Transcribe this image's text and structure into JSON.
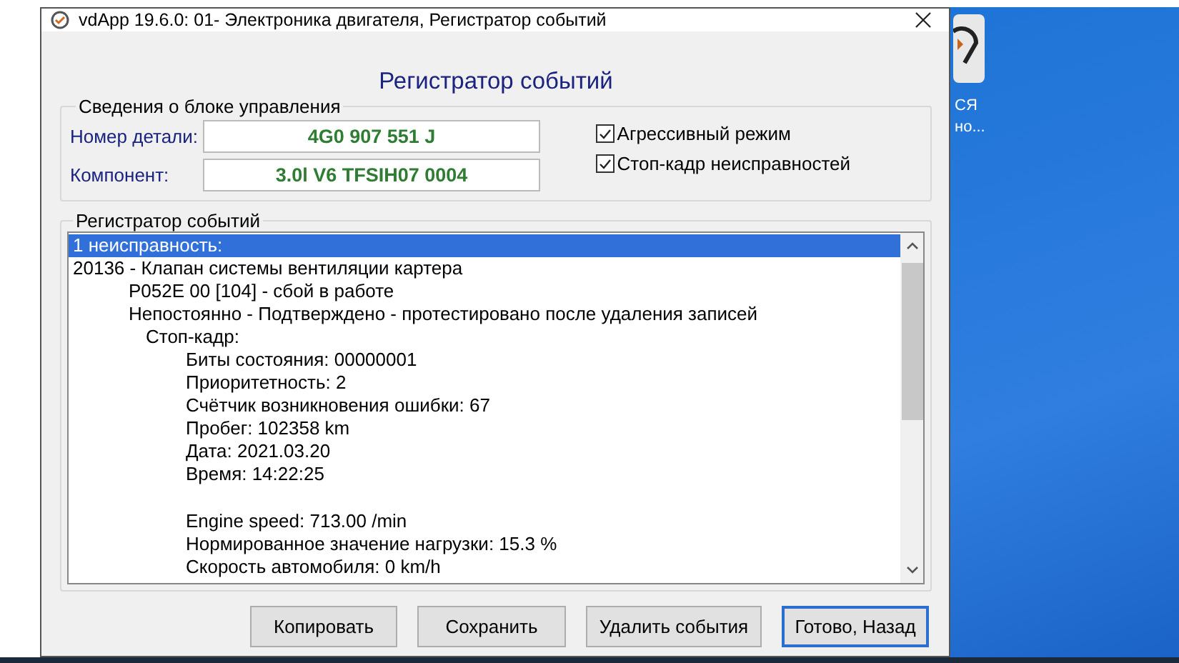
{
  "window": {
    "title": "vdApp 19.6.0: 01- Электроника двигателя,  Регистратор событий"
  },
  "heading": "Регистратор событий",
  "control_unit": {
    "title": "Сведения о блоке управления",
    "fields": [
      {
        "label": "Номер детали:",
        "value": "4G0 907 551 J"
      },
      {
        "label": "Компонент:",
        "value": "3.0l V6 TFSIH07 0004"
      }
    ],
    "options": [
      {
        "label": "Агрессивный режим",
        "checked": true
      },
      {
        "label": "Стоп-кадр неисправностей",
        "checked": true
      }
    ]
  },
  "event_log": {
    "title": "Регистратор событий",
    "items": [
      {
        "text": "1 неисправность:",
        "selected": true
      },
      {
        "text": "20136 - Клапан системы вентиляции картера",
        "selected": false,
        "children": [
          {
            "text": "P052E 00 [104] - сбой в работе",
            "selected": false
          },
          {
            "text": "Непостоянно - Подтверждено - протестировано после удаления записей",
            "selected": false,
            "children": [
              {
                "text": "Стоп-кадр:",
                "selected": false,
                "children": [
                  {
                    "text": "Биты состояния: 00000001",
                    "selected": false
                  },
                  {
                    "text": "Приоритетность: 2",
                    "selected": false
                  },
                  {
                    "text": "Счётчик возникновения ошибки: 67",
                    "selected": false
                  },
                  {
                    "text": "Пробег: 102358 km",
                    "selected": false
                  },
                  {
                    "text": "Дата: 2021.03.20",
                    "selected": false
                  },
                  {
                    "text": "Время: 14:22:25",
                    "selected": false
                  },
                  {
                    "text": "Engine speed: 713.00 /min",
                    "selected": false,
                    "gap_before": true
                  },
                  {
                    "text": "Нормированное значение нагрузки: 15.3 %",
                    "selected": false
                  },
                  {
                    "text": "Скорость автомобиля: 0 km/h",
                    "selected": false
                  }
                ]
              }
            ]
          }
        ]
      }
    ]
  },
  "buttons": [
    {
      "label": "Копировать",
      "default": false
    },
    {
      "label": "Сохранить",
      "default": false
    },
    {
      "label": "Удалить события",
      "default": false
    },
    {
      "label": "Готово, Назад",
      "default": true
    }
  ],
  "desktop_icon": {
    "label_lines": [
      "СЯ",
      "но..."
    ]
  }
}
